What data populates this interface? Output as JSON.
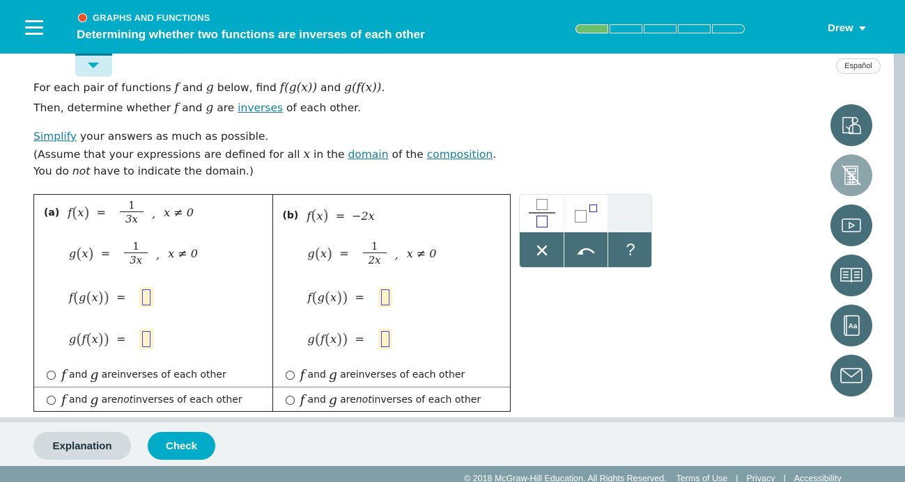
{
  "header": {
    "menu_icon": "hamburger-menu-icon",
    "topic": "GRAPHS AND FUNCTIONS",
    "topic_dot_color": "#f04e23",
    "title": "Determining whether two functions are inverses of each other",
    "progress": {
      "segments": 5,
      "filled": 1,
      "fill_color": "#6cbf6a"
    },
    "user": "Drew",
    "accent_color": "#00abc8"
  },
  "language_button": "Español",
  "instructions": {
    "line1": {
      "pre": "For each pair of functions ",
      "f": "f",
      "and": " and ",
      "g": "g",
      "mid": " below, find ",
      "fg": "f(g(x))",
      "and2": " and ",
      "gf": "g(f(x))",
      "end": "."
    },
    "line2": {
      "pre": "Then, determine whether ",
      "f": "f",
      "and": " and ",
      "g": "g",
      "mid": " are ",
      "link": "inverses",
      "end": " of each other."
    },
    "line3": {
      "link": "Simplify",
      "rest": " your answers as much as possible."
    },
    "line4": {
      "pre": "(Assume that your expressions are defined for all ",
      "x": "x",
      "mid": " in the ",
      "link1": "domain",
      "mid2": " of the ",
      "link2": "composition",
      "end": "."
    },
    "line5": {
      "pre": "You do ",
      "em": "not",
      "end": " have to indicate the domain.)"
    }
  },
  "problems": [
    {
      "label": "(a)",
      "f_def": {
        "lhs_fn": "f",
        "var": "x",
        "eq": "=",
        "num": "1",
        "den": "3x",
        "cond": "x ≠ 0"
      },
      "g_def": {
        "lhs_fn": "g",
        "var": "x",
        "eq": "=",
        "num": "1",
        "den": "3x",
        "cond": "x ≠ 0"
      },
      "fg_label": {
        "outer": "f",
        "inner": "g",
        "var": "x",
        "eq": "="
      },
      "gf_label": {
        "outer": "g",
        "inner": "f",
        "var": "x",
        "eq": "="
      },
      "fg_answer": "",
      "gf_answer": "",
      "options": [
        {
          "f": "f",
          "and": "and",
          "g": "g",
          "pre": "are ",
          "em": "",
          "post": "inverses of each other",
          "selected": false
        },
        {
          "f": "f",
          "and": "and",
          "g": "g",
          "pre": "are ",
          "em": "not",
          "post": " inverses of each other",
          "selected": false
        }
      ]
    },
    {
      "label": "(b)",
      "f_def": {
        "lhs_fn": "f",
        "var": "x",
        "eq": "=",
        "rhs": "−2x"
      },
      "g_def": {
        "lhs_fn": "g",
        "var": "x",
        "eq": "=",
        "num": "1",
        "den": "2x",
        "cond": "x ≠ 0"
      },
      "fg_label": {
        "outer": "f",
        "inner": "g",
        "var": "x",
        "eq": "="
      },
      "gf_label": {
        "outer": "g",
        "inner": "f",
        "var": "x",
        "eq": "="
      },
      "fg_answer": "",
      "gf_answer": "",
      "options": [
        {
          "f": "f",
          "and": "and",
          "g": "g",
          "pre": "are ",
          "em": "",
          "post": "inverses of each other",
          "selected": false
        },
        {
          "f": "f",
          "and": "and",
          "g": "g",
          "pre": "are ",
          "em": "not",
          "post": " inverses of each other",
          "selected": false
        }
      ]
    }
  ],
  "keypad": {
    "keys": [
      "fraction-template",
      "exponent-template",
      "clear",
      "undo",
      "help"
    ],
    "clear_label": "×",
    "help_label": "?"
  },
  "side_tools": [
    {
      "name": "ask-instructor",
      "icon": "instructor-icon",
      "enabled": true
    },
    {
      "name": "calculator",
      "icon": "calculator-disabled-icon",
      "enabled": false
    },
    {
      "name": "video",
      "icon": "video-play-icon",
      "enabled": true
    },
    {
      "name": "textbook",
      "icon": "open-book-icon",
      "enabled": true
    },
    {
      "name": "glossary",
      "icon": "dictionary-icon",
      "enabled": true,
      "glyph": "Aa"
    },
    {
      "name": "message",
      "icon": "envelope-icon",
      "enabled": true
    }
  ],
  "actions": {
    "explanation": "Explanation",
    "check": "Check"
  },
  "footer": {
    "copyright": "© 2018 McGraw-Hill Education. All Rights Reserved.",
    "links": [
      "Terms of Use",
      "Privacy",
      "Accessibility"
    ],
    "separator": "|"
  }
}
